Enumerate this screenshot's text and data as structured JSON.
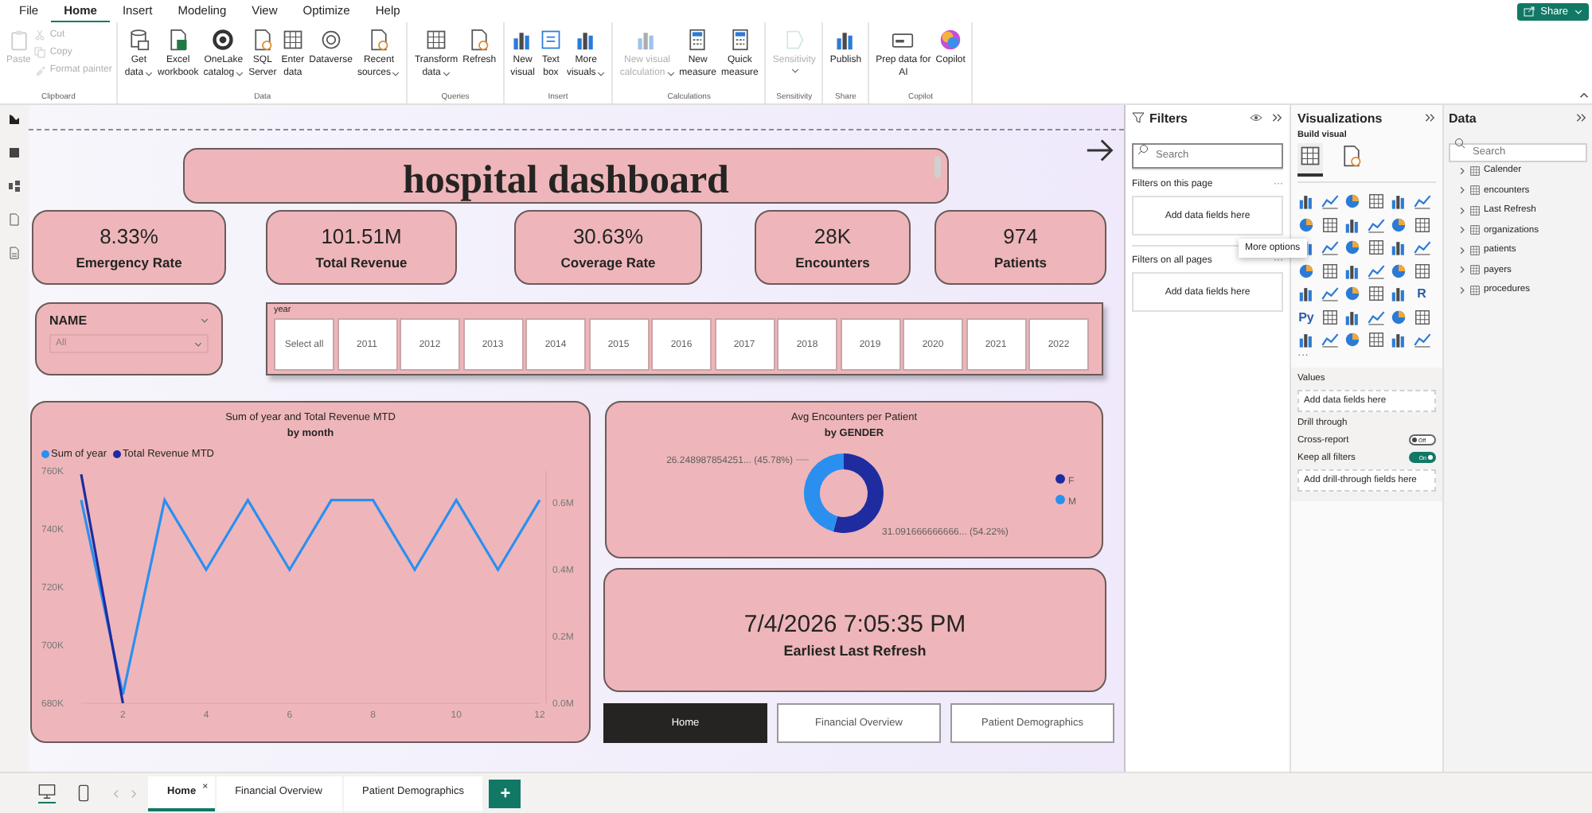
{
  "menu": {
    "tabs": [
      {
        "label": "File",
        "selected": false
      },
      {
        "label": "Home",
        "selected": true
      },
      {
        "label": "Insert",
        "selected": false
      },
      {
        "label": "Modeling",
        "selected": false
      },
      {
        "label": "View",
        "selected": false
      },
      {
        "label": "Optimize",
        "selected": false
      },
      {
        "label": "Help",
        "selected": false
      }
    ],
    "share": "Share"
  },
  "ribbon": {
    "groups": [
      {
        "label": "Clipboard",
        "items": [
          {
            "kind": "large",
            "lines": [
              "Paste"
            ],
            "disabled": true,
            "dropdown": false
          },
          {
            "kind": "small",
            "lines": [
              "Cut"
            ],
            "disabled": true
          },
          {
            "kind": "small",
            "lines": [
              "Copy"
            ],
            "disabled": true
          },
          {
            "kind": "small",
            "lines": [
              "Format painter"
            ],
            "disabled": true
          }
        ]
      },
      {
        "label": "Data",
        "items": [
          {
            "kind": "large",
            "lines": [
              "Get",
              "data"
            ],
            "disabled": false,
            "dropdown": true
          },
          {
            "kind": "large",
            "lines": [
              "Excel",
              "workbook"
            ],
            "disabled": false,
            "dropdown": false
          },
          {
            "kind": "large",
            "lines": [
              "OneLake",
              "catalog"
            ],
            "disabled": false,
            "dropdown": true
          },
          {
            "kind": "large",
            "lines": [
              "SQL",
              "Server"
            ],
            "disabled": false,
            "dropdown": false
          },
          {
            "kind": "large",
            "lines": [
              "Enter",
              "data"
            ],
            "disabled": false,
            "dropdown": false
          },
          {
            "kind": "large",
            "lines": [
              "Dataverse"
            ],
            "disabled": false,
            "dropdown": false
          },
          {
            "kind": "large",
            "lines": [
              "Recent",
              "sources"
            ],
            "disabled": false,
            "dropdown": true
          }
        ]
      },
      {
        "label": "Queries",
        "items": [
          {
            "kind": "large",
            "lines": [
              "Transform",
              "data"
            ],
            "disabled": false,
            "dropdown": true
          },
          {
            "kind": "large",
            "lines": [
              "Refresh"
            ],
            "disabled": false,
            "dropdown": false
          }
        ]
      },
      {
        "label": "Insert",
        "items": [
          {
            "kind": "large",
            "lines": [
              "New",
              "visual"
            ],
            "disabled": false,
            "dropdown": false
          },
          {
            "kind": "large",
            "lines": [
              "Text",
              "box"
            ],
            "disabled": false,
            "dropdown": false
          },
          {
            "kind": "large",
            "lines": [
              "More",
              "visuals"
            ],
            "disabled": false,
            "dropdown": true
          }
        ]
      },
      {
        "label": "Calculations",
        "items": [
          {
            "kind": "large",
            "lines": [
              "New visual",
              "calculation"
            ],
            "disabled": true,
            "dropdown": true
          },
          {
            "kind": "large",
            "lines": [
              "New",
              "measure"
            ],
            "disabled": false,
            "dropdown": false
          },
          {
            "kind": "large",
            "lines": [
              "Quick",
              "measure"
            ],
            "disabled": false,
            "dropdown": false
          }
        ]
      },
      {
        "label": "Sensitivity",
        "items": [
          {
            "kind": "large",
            "lines": [
              "Sensitivity"
            ],
            "disabled": true,
            "dropdown": true
          }
        ]
      },
      {
        "label": "Share",
        "items": [
          {
            "kind": "large",
            "lines": [
              "Publish"
            ],
            "disabled": false,
            "dropdown": false
          }
        ]
      },
      {
        "label": "Copilot",
        "items": [
          {
            "kind": "large",
            "lines": [
              "Prep data for",
              "AI"
            ],
            "disabled": false,
            "dropdown": false
          },
          {
            "kind": "large",
            "lines": [
              "Copilot"
            ],
            "disabled": false,
            "dropdown": false
          }
        ]
      }
    ]
  },
  "report": {
    "title": "hospital dashboard",
    "kpis": [
      {
        "value": "8.33%",
        "label": "Emergency Rate"
      },
      {
        "value": "101.51M",
        "label": "Total Revenue"
      },
      {
        "value": "30.63%",
        "label": "Coverage Rate"
      },
      {
        "value": "28K",
        "label": "Encounters"
      },
      {
        "value": "974",
        "label": "Patients"
      }
    ],
    "name_slicer": {
      "title": "NAME",
      "value": "All"
    },
    "year_slicer": {
      "title": "year",
      "options": [
        {
          "label": "Select all",
          "selected": false
        },
        {
          "label": "2011",
          "selected": false
        },
        {
          "label": "2012",
          "selected": false
        },
        {
          "label": "2013",
          "selected": false
        },
        {
          "label": "2014",
          "selected": false
        },
        {
          "label": "2015",
          "selected": false
        },
        {
          "label": "2016",
          "selected": false
        },
        {
          "label": "2017",
          "selected": false
        },
        {
          "label": "2018",
          "selected": false
        },
        {
          "label": "2019",
          "selected": false
        },
        {
          "label": "2020",
          "selected": false
        },
        {
          "label": "2021",
          "selected": false
        },
        {
          "label": "2022",
          "selected": false
        }
      ]
    },
    "line_chart": {
      "chart_data": {
        "type": "line",
        "title": "Sum of year and Total Revenue MTD",
        "subtitle": "by month",
        "x": [
          1,
          2,
          3,
          4,
          5,
          6,
          7,
          8,
          9,
          10,
          11,
          12
        ],
        "xlim": [
          1,
          12
        ],
        "xticks": [
          2,
          4,
          6,
          8,
          10,
          12
        ],
        "ylim": [
          680000,
          760000
        ],
        "yticks": [
          {
            "value": 680000,
            "label": "680K"
          },
          {
            "value": 700000,
            "label": "700K"
          },
          {
            "value": 720000,
            "label": "720K"
          },
          {
            "value": 740000,
            "label": "740K"
          },
          {
            "value": 760000,
            "label": "760K"
          }
        ],
        "y2lim": [
          0,
          695000
        ],
        "y2ticks": [
          {
            "value": 0,
            "label": "0.0M"
          },
          {
            "value": 200000,
            "label": "0.2M"
          },
          {
            "value": 400000,
            "label": "0.4M"
          },
          {
            "value": 600000,
            "label": "0.6M"
          }
        ],
        "series": [
          {
            "name": "Sum of year",
            "color": "#2b8ff0",
            "values": [
              750000,
              683000,
              750000,
              726000,
              750000,
              726000,
              750000,
              750000,
              726000,
              750000,
              726000,
              750000
            ]
          },
          {
            "name": "Total Revenue MTD",
            "color": "#1f2ca0",
            "axis": "y2",
            "values": [
              685000,
              0,
              null,
              null,
              null,
              null,
              null,
              null,
              null,
              null,
              null,
              null
            ]
          }
        ]
      }
    },
    "donut_chart": {
      "chart_data": {
        "type": "donut",
        "title": "Avg Encounters per Patient",
        "subtitle": "by GENDER",
        "categories": [
          "F",
          "M"
        ],
        "values": [
          31.091666666666,
          26.248987854251
        ],
        "colors": [
          "#1f2ca0",
          "#2b8ff0"
        ],
        "legend": true,
        "value_labels": [
          "31.091666666666... (54.22%)",
          "26.248987854251... (45.78%)"
        ]
      }
    },
    "refresh_card": {
      "value": "7/4/2026 7:05:35 PM",
      "label": "Earliest Last Refresh"
    },
    "nav_buttons": [
      {
        "label": "Home",
        "selected": true
      },
      {
        "label": "Financial Overview",
        "selected": false
      },
      {
        "label": "Patient Demographics",
        "selected": false
      }
    ]
  },
  "filters": {
    "title": "Filters",
    "search": {
      "placeholder": "Search"
    },
    "sections": [
      {
        "title": "Filters on this page",
        "more": "···",
        "drop_zone": "Add data fields here"
      },
      {
        "title": "Filters on all pages",
        "more": "···",
        "drop_zone": "Add data fields here"
      }
    ],
    "tooltip": "More options"
  },
  "visualizations": {
    "title": "Visualizations",
    "build_label": "Build visual",
    "modes": [
      {
        "selected": true
      },
      {
        "selected": false
      }
    ],
    "gallery": [
      {
        "kind": "icon"
      },
      {
        "kind": "icon"
      },
      {
        "kind": "icon"
      },
      {
        "kind": "icon"
      },
      {
        "kind": "icon"
      },
      {
        "kind": "icon"
      },
      {
        "kind": "icon"
      },
      {
        "kind": "icon"
      },
      {
        "kind": "icon"
      },
      {
        "kind": "icon"
      },
      {
        "kind": "icon"
      },
      {
        "kind": "icon"
      },
      {
        "kind": "icon"
      },
      {
        "kind": "icon"
      },
      {
        "kind": "icon"
      },
      {
        "kind": "icon"
      },
      {
        "kind": "icon"
      },
      {
        "kind": "icon"
      },
      {
        "kind": "icon"
      },
      {
        "kind": "icon"
      },
      {
        "kind": "icon"
      },
      {
        "kind": "icon"
      },
      {
        "kind": "icon"
      },
      {
        "kind": "icon"
      },
      {
        "kind": "icon"
      },
      {
        "kind": "icon"
      },
      {
        "kind": "icon"
      },
      {
        "kind": "icon"
      },
      {
        "kind": "icon"
      },
      {
        "kind": "glyph",
        "text": "R"
      },
      {
        "kind": "glyph",
        "text": "Py"
      },
      {
        "kind": "icon"
      },
      {
        "kind": "icon"
      },
      {
        "kind": "icon"
      },
      {
        "kind": "icon"
      },
      {
        "kind": "icon"
      },
      {
        "kind": "icon"
      },
      {
        "kind": "icon"
      },
      {
        "kind": "icon"
      },
      {
        "kind": "icon"
      },
      {
        "kind": "icon"
      },
      {
        "kind": "icon"
      }
    ],
    "more": "···",
    "values": {
      "title": "Values",
      "drop_zone": "Add data fields here"
    },
    "drill_through": {
      "title": "Drill through",
      "toggles": [
        {
          "label": "Cross-report",
          "on": false,
          "text": "Off"
        },
        {
          "label": "Keep all filters",
          "on": true,
          "text": "On"
        }
      ],
      "drop_zone": "Add drill-through fields here"
    }
  },
  "data": {
    "title": "Data",
    "search": {
      "placeholder": "Search"
    },
    "tables": [
      {
        "name": "Calender",
        "expanded": false
      },
      {
        "name": "encounters",
        "expanded": false
      },
      {
        "name": "Last Refresh",
        "expanded": false
      },
      {
        "name": "organizations",
        "expanded": false
      },
      {
        "name": "patients",
        "expanded": false
      },
      {
        "name": "payers",
        "expanded": false
      },
      {
        "name": "procedures",
        "expanded": false
      }
    ]
  },
  "pages": {
    "tabs": [
      {
        "label": "Home",
        "selected": true,
        "close_glyph": "×"
      },
      {
        "label": "Financial Overview",
        "selected": false
      },
      {
        "label": "Patient Demographics",
        "selected": false
      }
    ],
    "add": "+"
  }
}
